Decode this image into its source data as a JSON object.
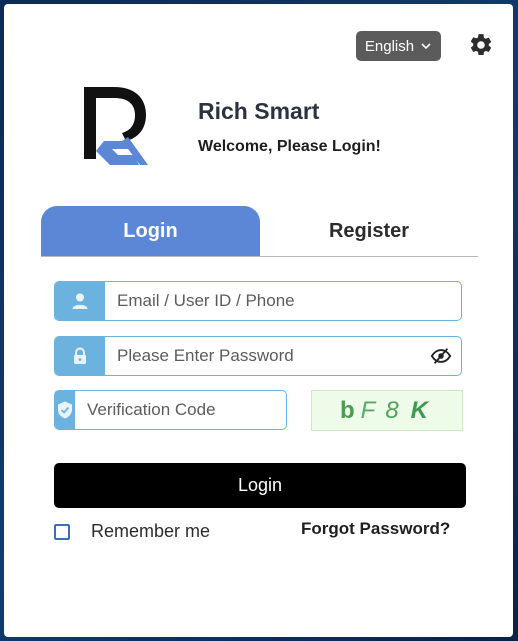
{
  "header": {
    "language": "English",
    "settings_icon": "gear-icon"
  },
  "brand": {
    "name": "Rich Smart",
    "welcome": "Welcome, Please Login!"
  },
  "tabs": [
    {
      "label": "Login",
      "active": true
    },
    {
      "label": "Register",
      "active": false
    }
  ],
  "form": {
    "account": {
      "placeholder": "Email / User ID / Phone",
      "value": "",
      "icon": "user-icon"
    },
    "password": {
      "placeholder": "Please Enter Password",
      "value": "",
      "icon": "lock-icon",
      "toggle_icon": "eye-slash-icon"
    },
    "verification": {
      "placeholder": "Verification Code",
      "value": "",
      "icon": "shield-check-icon"
    },
    "captcha": {
      "characters": [
        "b",
        "F",
        "8",
        "K"
      ]
    },
    "submit_label": "Login",
    "remember_label": "Remember me",
    "remember_checked": false,
    "forgot_label": "Forgot Password?"
  },
  "colors": {
    "accent_tab": "#5b87d6",
    "field_icon_bg": "#6cb2df",
    "button_bg": "#000000",
    "captcha_bg": "#eefbe9"
  }
}
